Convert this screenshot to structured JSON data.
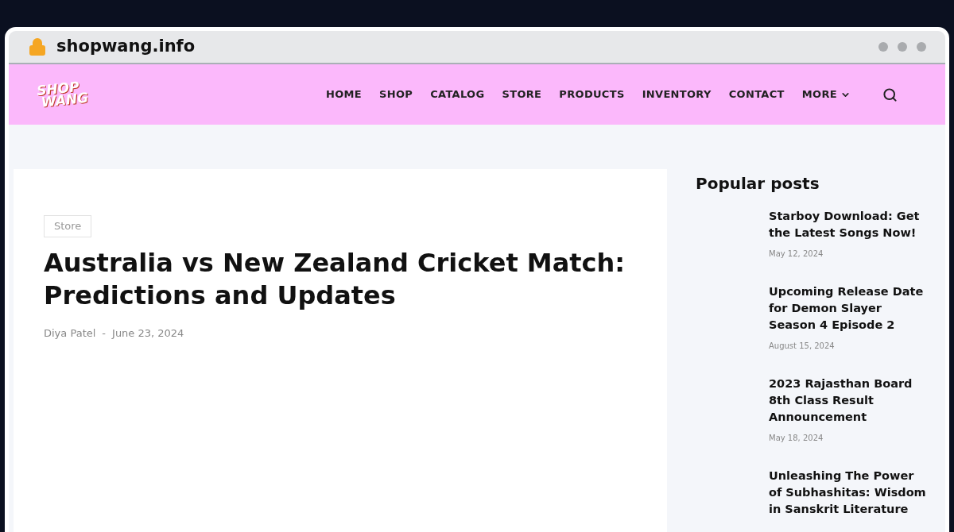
{
  "browser": {
    "address": "shopwang.info"
  },
  "header": {
    "logo": {
      "line1": "SHOP",
      "line2": "WANG"
    },
    "nav": [
      {
        "label": "HOME",
        "has_menu": false
      },
      {
        "label": "SHOP",
        "has_menu": false
      },
      {
        "label": "CATALOG",
        "has_menu": false
      },
      {
        "label": "STORE",
        "has_menu": false
      },
      {
        "label": "PRODUCTS",
        "has_menu": false
      },
      {
        "label": "INVENTORY",
        "has_menu": false
      },
      {
        "label": "CONTACT",
        "has_menu": false
      },
      {
        "label": "MORE",
        "has_menu": true
      }
    ]
  },
  "article": {
    "category": "Store",
    "title": "Australia vs New Zealand Cricket Match: Predictions and Updates",
    "author": "Diya Patel",
    "separator": "-",
    "date": "June 23, 2024"
  },
  "sidebar": {
    "heading": "Popular posts",
    "posts": [
      {
        "title": "Starboy Download: Get the Latest Songs Now!",
        "date": "May 12, 2024"
      },
      {
        "title": "Upcoming Release Date for Demon Slayer Season 4 Episode 2",
        "date": "August 15, 2024"
      },
      {
        "title": "2023 Rajasthan Board 8th Class Result Announcement",
        "date": "May 18, 2024"
      },
      {
        "title": "Unleashing The Power of Subhashitas: Wisdom in Sanskrit Literature"
      }
    ]
  }
}
